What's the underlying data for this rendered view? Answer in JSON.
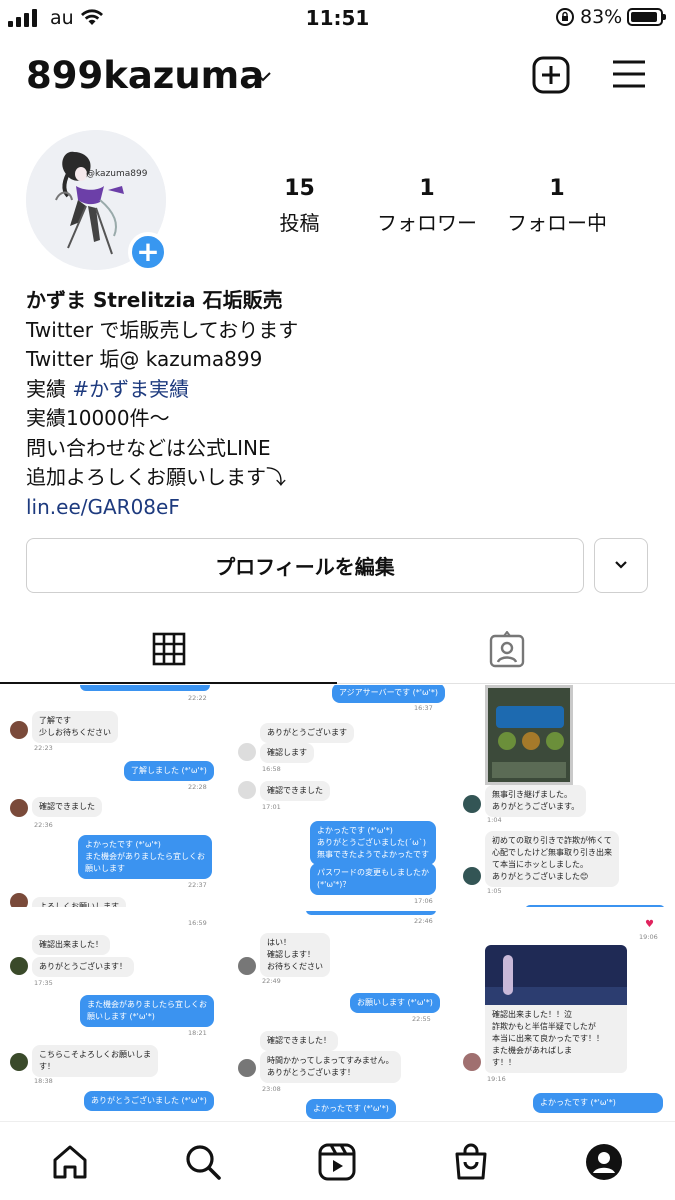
{
  "status": {
    "carrier": "au",
    "time": "11:51",
    "battery": "83%"
  },
  "header": {
    "username": "899kazuma"
  },
  "profile": {
    "avatar_watermark": "@kazuma899",
    "stats": [
      {
        "value": "15",
        "label": "投稿"
      },
      {
        "value": "1",
        "label": "フォロワー"
      },
      {
        "value": "1",
        "label": "フォロー中"
      }
    ],
    "name": "かずま Strelitzia 石垢販売",
    "bio_lines": [
      "Twitter で垢販売しております",
      "Twitter 垢@ kazuma899"
    ],
    "bio_jisseki_prefix": "実績 ",
    "bio_hashtag": "#かずま実績",
    "bio_lines2": [
      "実績10000件〜",
      "問い合わせなどは公式LINE",
      "追加よろしくお願いします⤵︎"
    ],
    "link": "lin.ee/GAR08eF",
    "edit_label": "プロフィールを編集"
  },
  "grid": {
    "post1": {
      "b1": "了解です\n少しお待ちください",
      "t1": "22:23",
      "b2": "了解しました (*'ω'*)",
      "t2": "22:28",
      "b3": "確認できました",
      "t3": "22:36",
      "b4": "よかったです (*'ω'*)\nまた機会がありましたら宜しくお\n願いします",
      "t4": "22:37",
      "b5": "よろしくお願いします",
      "t0": "22:22"
    },
    "post2": {
      "top": "アジアサーバーです (*'ω'*)",
      "t0": "16:37",
      "b1": "ありがとうございます",
      "b2": "確認します",
      "t2": "16:58",
      "b3": "確認できました",
      "t3": "17:01",
      "b4": "よかったです (*'ω'*)\nありがとうございました(´ω`)\n無事できたようでよかったです",
      "b5": "パスワードの変更もしましたか\n(*'ω'*)？",
      "t5": "17:06"
    },
    "post3": {
      "b1": "無事引き継げました。\nありがとうございます。",
      "t1": "1:04",
      "b2": "初めての取り引きで詐欺が怖くて\n心配でしたけど無事取り引き出来\nて本当にホッとしました。\nありがとうございました😊",
      "t2": "1:05"
    },
    "post4": {
      "t0": "16:59",
      "b1": "確認出来ました！",
      "b2": "ありがとうございます！",
      "t2": "17:35",
      "b3": "また機会がありましたら宜しくお\n願いします (*'ω'*)",
      "t3": "18:21",
      "b4": "こちらこそよろしくお願いします！",
      "t4": "18:38",
      "b5": "ありがとうございました (*'ω'*)"
    },
    "post5": {
      "t0": "22:46",
      "b1": "はい！\n確認します！\nお待ちください",
      "t1": "22:49",
      "b2": "お願いします (*'ω'*)",
      "t2": "22:55",
      "b3": "確認できました！",
      "b4": "時間かかってしまってすみません。\nありがとうございます！",
      "t4": "23:08",
      "b5": "よかったです (*'ω'*)"
    },
    "post6": {
      "t0": "19:06",
      "b1": "確認出来ました！！泣\n詐欺かもと半信半疑でしたが\n本当に出来て良かったです！！\nまた機会があればしま\nす！！",
      "t1": "19:16",
      "b2": "よかったです (*'ω'*)"
    }
  },
  "colors": {
    "accent": "#3897f0",
    "link": "#1d3a7e",
    "bubble_blue": "#3b93f0"
  },
  "icons": [
    "signal-icon",
    "wifi-icon",
    "rotation-lock-icon",
    "battery-icon",
    "chevron-down-icon",
    "add-post-icon",
    "menu-icon",
    "grid-icon",
    "tagged-icon",
    "home-icon",
    "search-icon",
    "reels-icon",
    "shop-icon",
    "profile-icon"
  ]
}
